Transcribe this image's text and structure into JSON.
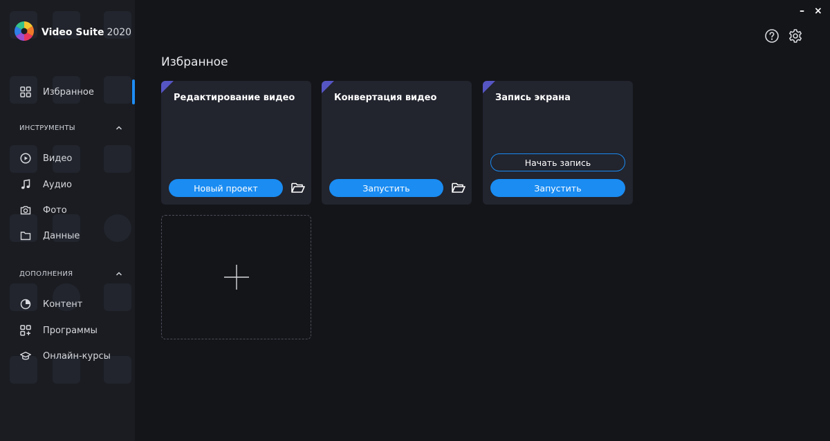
{
  "app": {
    "name": "Video Suite",
    "year": "2020"
  },
  "window": {
    "minimize_glyph": "–",
    "close_glyph": "×"
  },
  "toolbar": {
    "help_icon": "question-circle-icon",
    "settings_icon": "gear-icon"
  },
  "sidebar": {
    "favorites_label": "Избранное",
    "tools_header": "ИНСТРУМЕНТЫ",
    "tools": [
      {
        "label": "Видео",
        "icon": "play-circle-icon"
      },
      {
        "label": "Аудио",
        "icon": "music-note-icon"
      },
      {
        "label": "Фото",
        "icon": "camera-icon"
      },
      {
        "label": "Данные",
        "icon": "folder-icon"
      }
    ],
    "addons_header": "ДОПОЛНЕНИЯ",
    "addons": [
      {
        "label": "Контент",
        "icon": "pie-chart-icon"
      },
      {
        "label": "Программы",
        "icon": "grid-plus-icon"
      },
      {
        "label": "Онлайн-курсы",
        "icon": "graduation-cap-icon"
      }
    ]
  },
  "main": {
    "title": "Избранное",
    "cards": [
      {
        "title": "Редактирование видео",
        "primary_button": "Новый проект"
      },
      {
        "title": "Конвертация видео",
        "primary_button": "Запустить"
      },
      {
        "title": "Запись экрана",
        "secondary_button": "Начать запись",
        "primary_button": "Запустить"
      }
    ]
  },
  "colors": {
    "accent": "#1a8cf2",
    "corner_badge": "#5655c4",
    "background": "#141519",
    "sidebar": "#1a1c22",
    "card": "#22242e"
  }
}
